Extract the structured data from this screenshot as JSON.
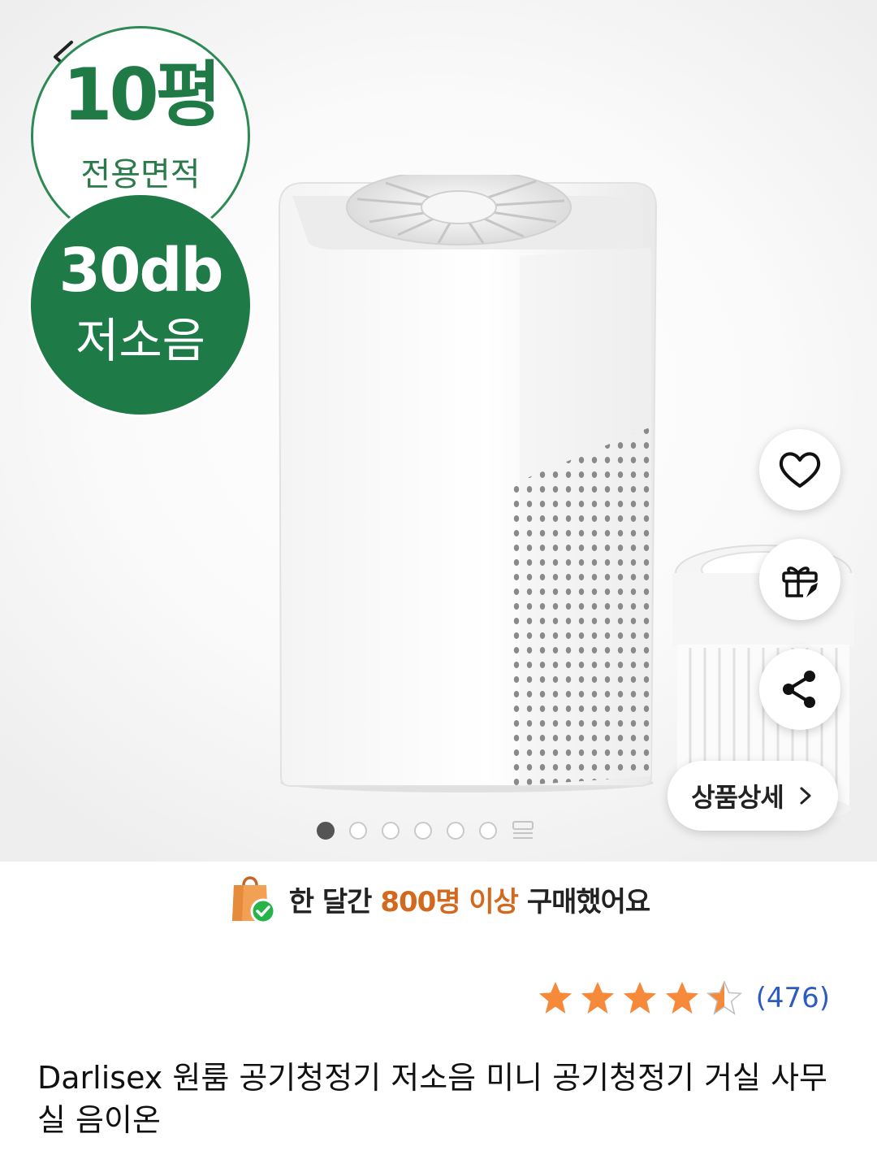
{
  "badges": {
    "area_value": "10평",
    "area_label": "전용면적",
    "noise_value": "30db",
    "noise_label": "저소음"
  },
  "actions": {
    "detail_label": "상품상세"
  },
  "pagination": {
    "total_visible_dots": 6,
    "active_index": 0
  },
  "purchase_note": {
    "prefix": "한 달간",
    "highlight": "800명 이상",
    "suffix": "구매했어요"
  },
  "rating": {
    "stars": 4.5,
    "count_text": "(476)"
  },
  "product": {
    "title": "Darlisex 원룸 공기청정기 저소음 미니 공기청정기 거실 사무실 음이온"
  },
  "colors": {
    "badge_green": "#1e7a47",
    "star_orange": "#f7893a",
    "highlight_orange": "#d2691e",
    "review_link": "#2e5bbf"
  },
  "icons": {
    "back": "chevron-left-icon",
    "wish": "heart-icon",
    "gift": "gift-icon",
    "share": "share-icon",
    "more": "grid-icon",
    "purchase": "shopping-bag-check-icon"
  }
}
